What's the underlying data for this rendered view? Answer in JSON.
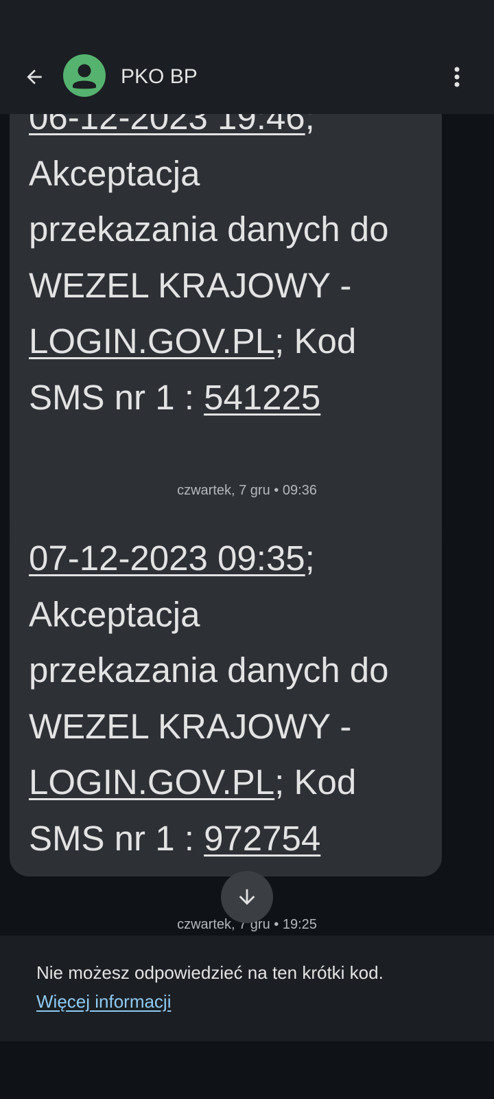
{
  "header": {
    "back_icon": "arrow-left-icon",
    "avatar_icon": "person-icon",
    "avatar_color": "#55b36f",
    "contact_name": "PKO BP",
    "more_icon": "more-vert-icon"
  },
  "messages": [
    {
      "date_time": "06-12-2023 19:46",
      "sep_after_date": ";",
      "text_line2": "Akceptacja",
      "text_line3": "przekazania danych do",
      "text_line4": "WEZEL KRAJOWY -",
      "link": "LOGIN.GOV.PL",
      "after_link": "; Kod",
      "code_prefix": "SMS nr 1 : ",
      "code": "541225"
    },
    {
      "date_time": "07-12-2023 09:35",
      "sep_after_date": ";",
      "text_line2": "Akceptacja",
      "text_line3": "przekazania danych do",
      "text_line4": "WEZEL KRAJOWY -",
      "link": "LOGIN.GOV.PL",
      "after_link": "; Kod",
      "code_prefix": "SMS nr 1 : ",
      "code": "972754"
    }
  ],
  "separators": [
    "czwartek, 7 gru • 09:36",
    "czwartek, 7 gru • 19:25"
  ],
  "scroll_down_icon": "arrow-down-icon",
  "footer": {
    "notice": "Nie możesz odpowiedzieć na ten krótki kod.",
    "link": "Więcej informacji"
  },
  "colors": {
    "background": "#0f1216",
    "bar": "#1b1e22",
    "bubble": "#2d3035",
    "link": "#8ecbf5"
  }
}
